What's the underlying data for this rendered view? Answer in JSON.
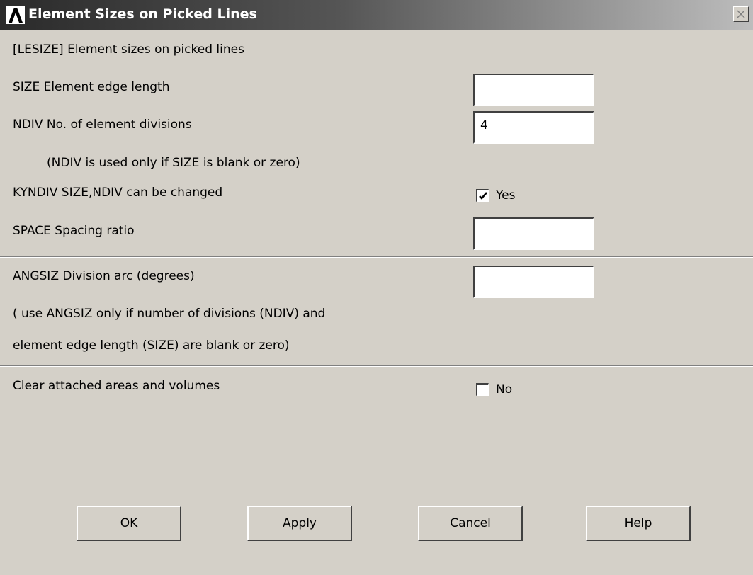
{
  "window": {
    "title": "Element Sizes on Picked Lines",
    "logo_icon": "ansys-logo-icon",
    "close_icon": "close-icon"
  },
  "header": {
    "command_label": "[LESIZE]  Element sizes on picked lines"
  },
  "fields": {
    "size": {
      "label": "SIZE    Element edge length",
      "value": ""
    },
    "ndiv": {
      "label": "NDIV    No. of element divisions",
      "value": "4"
    },
    "ndiv_note": "(NDIV is used only if SIZE is blank or zero)",
    "kyndiv": {
      "label": "KYNDIV  SIZE,NDIV can be changed",
      "checked": true,
      "check_label": "Yes"
    },
    "space": {
      "label": "SPACE   Spacing ratio",
      "value": ""
    },
    "angsiz": {
      "label": "ANGSIZ  Division arc (degrees)",
      "value": ""
    },
    "angsiz_note_1": "( use ANGSIZ only if number of divisions (NDIV) and",
    "angsiz_note_2": "element edge length (SIZE) are blank or zero)",
    "clear": {
      "label": "Clear attached areas and volumes",
      "checked": false,
      "check_label": "No"
    }
  },
  "buttons": {
    "ok": "OK",
    "apply": "Apply",
    "cancel": "Cancel",
    "help": "Help"
  },
  "colors": {
    "dialog_bg": "#d4d0c8",
    "title_bar_start": "#2a2a2a",
    "title_bar_end": "#bdbdbd",
    "title_text": "#ffffff"
  }
}
